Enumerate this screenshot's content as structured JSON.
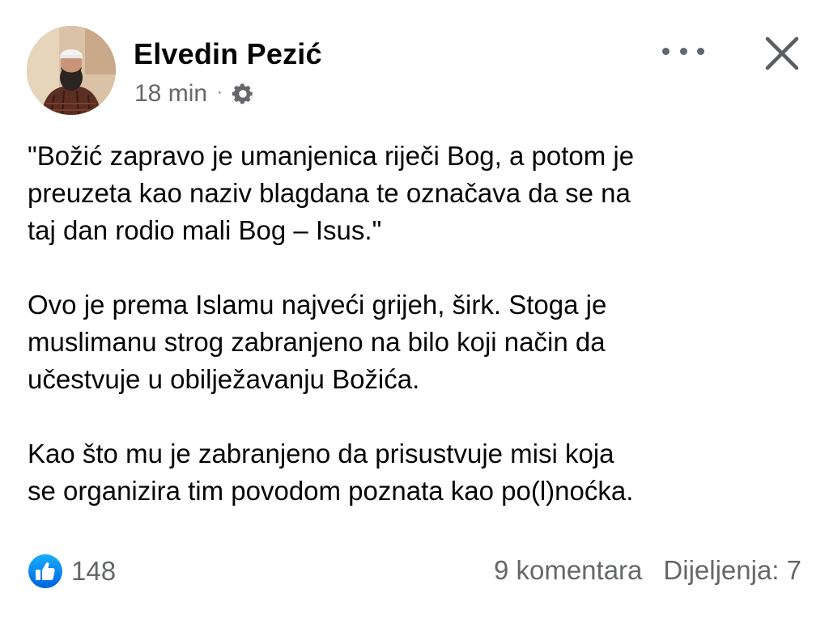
{
  "post": {
    "author": "Elvedin Pezić",
    "time": "18 min",
    "separator": "·",
    "privacy_icon": "gear-icon",
    "paragraphs": [
      "\"Božić zapravo je umanjenica riječi Bog, a potom je\npreuzeta kao naziv blagdana te označava da se na\ntaj dan rodio mali Bog – Isus.\"",
      "Ovo je prema Islamu najveći grijeh, širk. Stoga je\nmuslimanu strog zabranjeno na bilo koji način da\nučestvuje u obilježavanju Božića.",
      "Kao što mu je zabranjeno da prisustvuje misi koja\nse organizira tim povodom poznata kao po(l)noćka."
    ]
  },
  "footer": {
    "like_count": "148",
    "comments": "9 komentara",
    "shares": "Dijeljenja: 7"
  },
  "icons": {
    "more": "more-dots-icon",
    "close": "close-icon",
    "like": "like-icon"
  },
  "colors": {
    "text": "#050505",
    "secondary": "#65676b",
    "like_blue": "#1877f2"
  }
}
